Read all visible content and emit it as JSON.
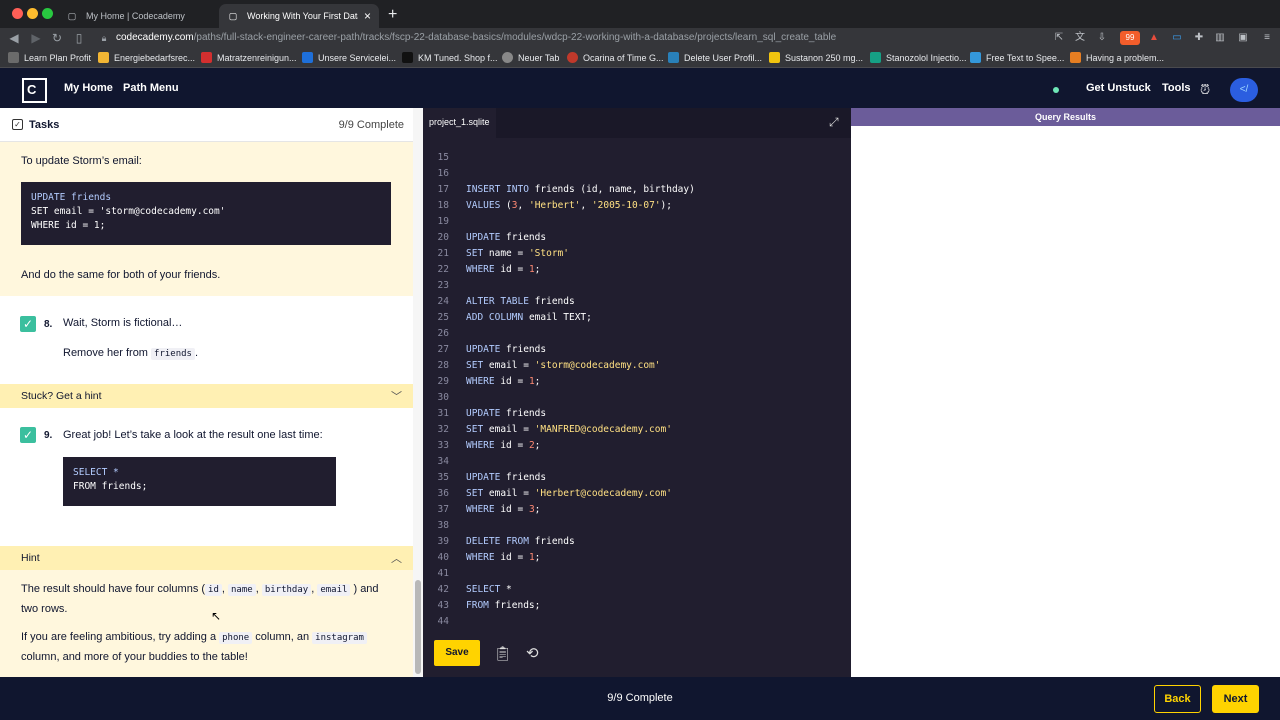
{
  "browser": {
    "tabs": [
      {
        "label": "My Home | Codecademy",
        "icon": "codecademy-favicon"
      },
      {
        "label": "Working With Your First Databa",
        "icon": "codecademy-favicon"
      }
    ],
    "new_tab": "+",
    "url_host": "codecademy.com",
    "url_path": "/paths/full-stack-engineer-career-path/tracks/fscp-22-database-basics/modules/wdcp-22-working-with-a-database/projects/learn_sql_create_table",
    "extension_badge": "99",
    "bookmarks": [
      "Learn Plan Profit",
      "Energiebedarfsrec...",
      "Matratzenreinigun...",
      "Unsere Servicelei...",
      "KM Tuned. Shop f...",
      "Neuer Tab",
      "Ocarina of Time G...",
      "Delete User Profil...",
      "Sustanon 250 mg...",
      "Stanozolol Injectio...",
      "Free Text to Spee...",
      "Having a problem..."
    ]
  },
  "header": {
    "logo": "C",
    "nav": [
      "My Home",
      "Path Menu"
    ],
    "get_unstuck": "Get Unstuck",
    "tools": "Tools"
  },
  "tasks": {
    "title": "Tasks",
    "progress": "9/9 Complete",
    "update_intro": "To update Storm’s email:",
    "update_code": [
      "UPDATE friends",
      "SET email = 'storm@codecademy.com'",
      "WHERE id = 1;"
    ],
    "same_text": "And do the same for both of your friends.",
    "step8": {
      "num": "8.",
      "title": "Wait, Storm is fictional…",
      "body_pre": "Remove her from",
      "body_code": "friends",
      "body_post": "."
    },
    "stuck_hint": "Stuck? Get a hint",
    "step9": {
      "num": "9.",
      "title": "Great job! Let’s take a look at the result one last time:",
      "code": [
        "SELECT *",
        "FROM friends;"
      ]
    },
    "hint_label": "Hint",
    "hint": {
      "p1_a": "The result should have four columns (",
      "c1": "id",
      "c2": "name",
      "c3": "birthday",
      "c4": "email",
      "p1_b": ") and",
      "p1_c": "two rows.",
      "p2_a": "If you are feeling ambitious, try adding a",
      "c5": "phone",
      "p2_b": "column, an",
      "c6": "instagram",
      "p2_c": "column, and more of your buddies to the table!"
    }
  },
  "editor": {
    "filename": "project_1.sqlite",
    "lines": [
      {
        "n": "15",
        "t": ""
      },
      {
        "n": "16",
        "t": ""
      },
      {
        "n": "17",
        "t": "INSERT INTO friends (id, name, birthday)"
      },
      {
        "n": "18",
        "t": "VALUES (3, 'Herbert', '2005-10-07');"
      },
      {
        "n": "19",
        "t": ""
      },
      {
        "n": "20",
        "t": "UPDATE friends"
      },
      {
        "n": "21",
        "t": "SET name = 'Storm'"
      },
      {
        "n": "22",
        "t": "WHERE id = 1;"
      },
      {
        "n": "23",
        "t": ""
      },
      {
        "n": "24",
        "t": "ALTER TABLE friends"
      },
      {
        "n": "25",
        "t": "ADD COLUMN email TEXT;"
      },
      {
        "n": "26",
        "t": ""
      },
      {
        "n": "27",
        "t": "UPDATE friends"
      },
      {
        "n": "28",
        "t": "SET email = 'storm@codecademy.com'"
      },
      {
        "n": "29",
        "t": "WHERE id = 1;"
      },
      {
        "n": "30",
        "t": ""
      },
      {
        "n": "31",
        "t": "UPDATE friends"
      },
      {
        "n": "32",
        "t": "SET email = 'MANFRED@codecademy.com'"
      },
      {
        "n": "33",
        "t": "WHERE id = 2;"
      },
      {
        "n": "34",
        "t": ""
      },
      {
        "n": "35",
        "t": "UPDATE friends"
      },
      {
        "n": "36",
        "t": "SET email = 'Herbert@codecademy.com'"
      },
      {
        "n": "37",
        "t": "WHERE id = 3;"
      },
      {
        "n": "38",
        "t": ""
      },
      {
        "n": "39",
        "t": "DELETE FROM friends"
      },
      {
        "n": "40",
        "t": "WHERE id = 1;"
      },
      {
        "n": "41",
        "t": ""
      },
      {
        "n": "42",
        "t": "SELECT *"
      },
      {
        "n": "43",
        "t": "FROM friends;"
      },
      {
        "n": "44",
        "t": ""
      }
    ],
    "save": "Save"
  },
  "results": {
    "title": "Query Results"
  },
  "footer": {
    "progress": "9/9 Complete",
    "back": "Back",
    "next": "Next"
  },
  "colors": {
    "brand_yellow": "#ffd300",
    "navy": "#10162f",
    "editor_bg": "#211e2f",
    "check_green": "#3bbf9e",
    "results_header": "#6b5c9a"
  }
}
